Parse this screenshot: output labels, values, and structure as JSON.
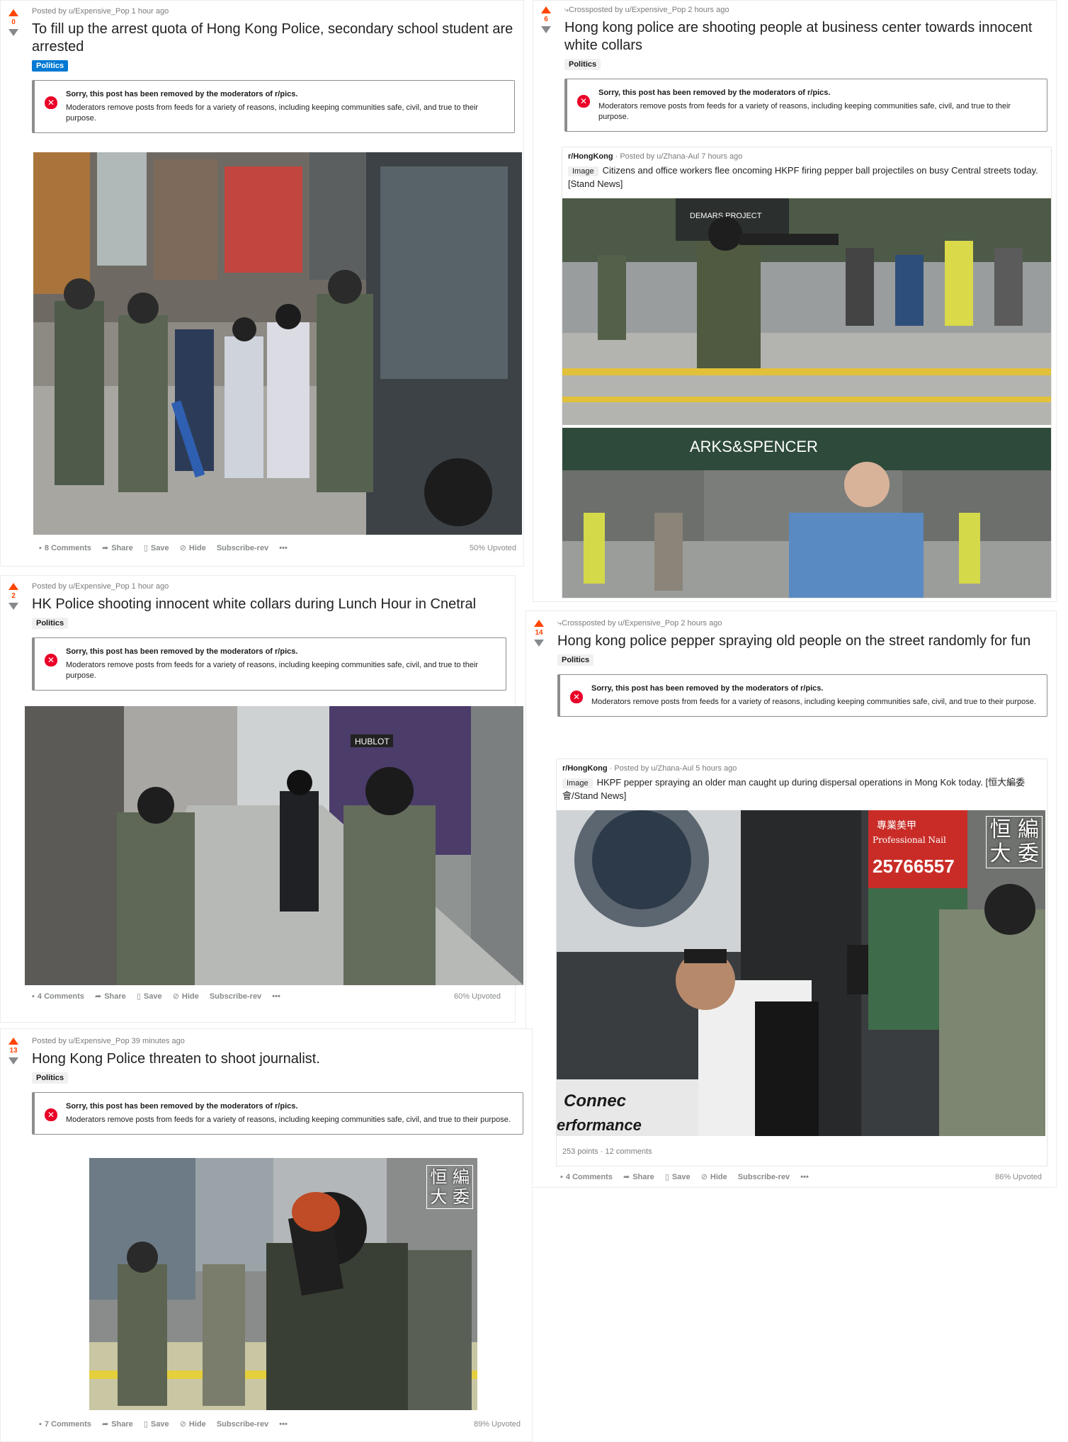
{
  "removed_notice": {
    "title": "Sorry, this post has been removed by the moderators of r/pics.",
    "text": "Moderators remove posts from feeds for a variety of reasons, including keeping communities safe, civil, and true to their purpose."
  },
  "actions": {
    "share": "Share",
    "save": "Save",
    "hide": "Hide",
    "subscribe": "Subscribe-rev",
    "more": "•••"
  },
  "posts": [
    {
      "score": "0",
      "meta": "Posted by u/Expensive_Pop 1 hour ago",
      "title": "To fill up the arrest quota of Hong Kong Police, secondary school student are arrested",
      "flair": "Politics",
      "comments": "8 Comments",
      "upvoted": "50% Upvoted"
    },
    {
      "score": "6",
      "crosspost": "Crossposted by",
      "meta": "u/Expensive_Pop 2 hours ago",
      "title": "Hong kong police are shooting people at business center towards innocent white collars",
      "flair": "Politics",
      "xpost": {
        "subreddit": "r/HongKong",
        "meta": "· Posted by u/Zhana-Aul 7 hours ago",
        "tag": "Image",
        "title": "Citizens and office workers flee oncoming HKPF firing pepper ball projectiles on busy Central streets today. [Stand News]",
        "photo_text_top": "DEMARS PROJECT",
        "photo_text_bottom": "ARKS&SPENCER"
      }
    },
    {
      "score": "2",
      "meta": "Posted by u/Expensive_Pop 1 hour ago",
      "title": "HK Police shooting innocent white collars during Lunch Hour in Cnetral",
      "flair": "Politics",
      "comments": "4 Comments",
      "upvoted": "60% Upvoted",
      "photo_text": "HUBLOT"
    },
    {
      "score": "14",
      "crosspost": "Crossposted by",
      "meta": "u/Expensive_Pop 2 hours ago",
      "title": "Hong kong police pepper spraying old people on the street randomly for fun",
      "flair": "Politics",
      "xpost": {
        "subreddit": "r/HongKong",
        "meta": "· Posted by u/Zhana-Aul 5 hours ago",
        "tag": "Image",
        "title": "HKPF pepper spraying an older man caught up during dispersal operations in Mong Kok today. [恒大編委會/Stand News]",
        "footer": "253 points · 12 comments",
        "sign_text_1": "專業美甲",
        "sign_text_2": "Professional Nail",
        "sign_text_3": "25766557",
        "watermark_1": "恒 編",
        "watermark_2": "大 委",
        "ad_text_1": "Connec",
        "ad_text_2": "erformance"
      },
      "comments": "4 Comments",
      "upvoted": "86% Upvoted"
    },
    {
      "score": "13",
      "meta": "Posted by u/Expensive_Pop 39 minutes ago",
      "title": "Hong Kong Police threaten to shoot journalist.",
      "flair": "Politics",
      "comments": "7 Comments",
      "upvoted": "89% Upvoted",
      "watermark_1": "恒 編",
      "watermark_2": "大 委"
    }
  ]
}
